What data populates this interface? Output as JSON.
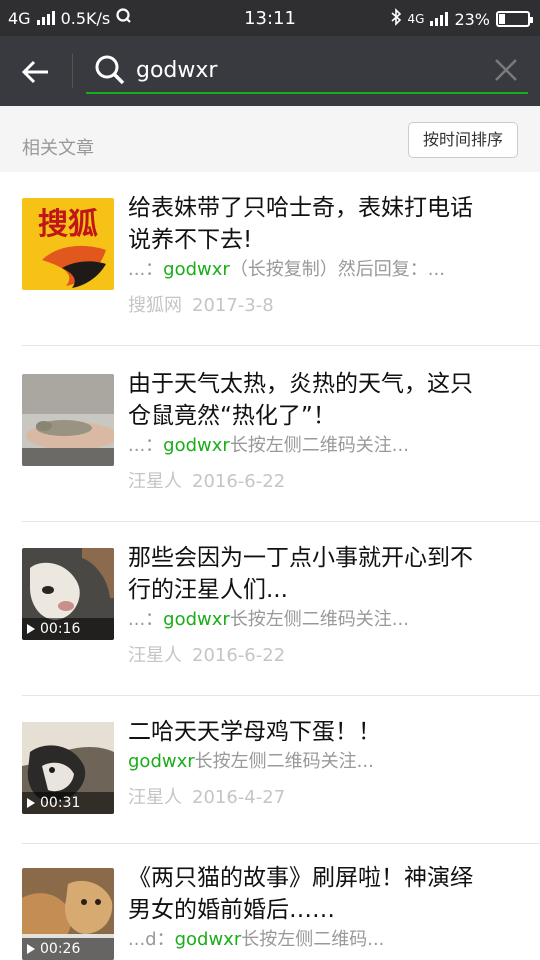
{
  "status_bar": {
    "network": "4G",
    "speed": "0.5K/s",
    "time": "13:11",
    "network_right": "4G",
    "battery": "23%",
    "battery_level": 0.23
  },
  "search": {
    "query": "godwxr",
    "icons": [
      "back-arrow-icon",
      "search-icon",
      "clear-icon"
    ],
    "accent_color": "#1aad19"
  },
  "section": {
    "title": "相关文章",
    "sort_label": "按时间排序"
  },
  "results": [
    {
      "title_lines": [
        "给表妹带了只哈士奇，表妹打电话",
        "说养不下去!"
      ],
      "snippet_prefix": "...：",
      "snippet_highlight": "godwxr",
      "snippet_suffix": "（长按复制）然后回复：...",
      "source": "搜狐网",
      "date": "2017-3-8",
      "thumb": "sohu-logo",
      "thumb_text": "搜狐",
      "duration": ""
    },
    {
      "title_lines": [
        "由于天气太热，炎热的天气，这只",
        "仓鼠竟然“热化了”！"
      ],
      "snippet_prefix": "...：",
      "snippet_highlight": "godwxr",
      "snippet_suffix": "长按左侧二维码关注...",
      "source": "汪星人",
      "date": "2016-6-22",
      "thumb": "hamster-photo",
      "duration": ""
    },
    {
      "title_lines": [
        "那些会因为一丁点小事就开心到不",
        "行的汪星人们..."
      ],
      "snippet_prefix": "...：",
      "snippet_highlight": "godwxr",
      "snippet_suffix": "长按左侧二维码关注...",
      "source": "汪星人",
      "date": "2016-6-22",
      "thumb": "dog-video",
      "duration": "00:16"
    },
    {
      "title_lines": [
        "二哈天天学母鸡下蛋！！"
      ],
      "snippet_prefix": "",
      "snippet_highlight": "godwxr",
      "snippet_suffix": "长按左侧二维码关注...",
      "source": "汪星人",
      "date": "2016-4-27",
      "thumb": "husky-video",
      "duration": "00:31"
    },
    {
      "title_lines": [
        "《两只猫的故事》刷屏啦！神演绎",
        "男女的婚前婚后……"
      ],
      "snippet_prefix": "...d：",
      "snippet_highlight": "godwxr",
      "snippet_suffix": "长按左侧二维码...",
      "source": "",
      "date": "",
      "thumb": "cats-video",
      "duration": "00:26"
    }
  ]
}
